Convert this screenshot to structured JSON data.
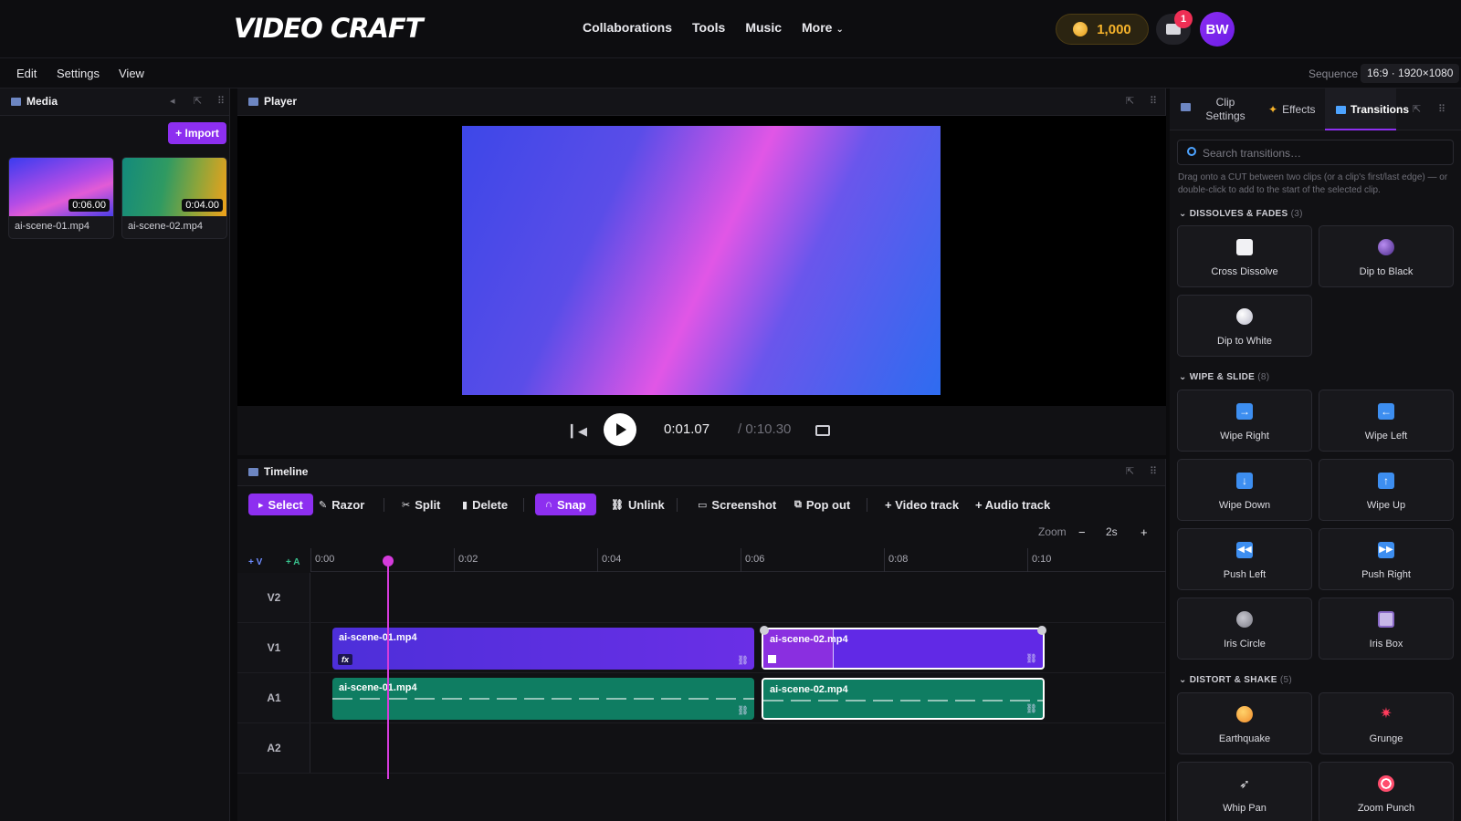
{
  "header": {
    "logo": "VIDEO CRAFT",
    "nav": [
      "Collaborations",
      "Tools",
      "Music",
      "More"
    ],
    "coins": "1,000",
    "notifications": "1",
    "avatar": "BW"
  },
  "menubar": {
    "items": [
      "Edit",
      "Settings",
      "View"
    ],
    "sequence_label": "Sequence",
    "sequence_value": "16:9 · 1920×1080"
  },
  "media": {
    "title": "Media",
    "import_label": "+ Import",
    "items": [
      {
        "name": "ai-scene-01.mp4",
        "duration": "0:06.00"
      },
      {
        "name": "ai-scene-02.mp4",
        "duration": "0:04.00"
      }
    ]
  },
  "player": {
    "title": "Player",
    "current_time": "0:01.07",
    "total_time": "/ 0:10.30"
  },
  "timeline": {
    "title": "Timeline",
    "tools": {
      "select": "Select",
      "razor": "Razor",
      "split": "Split",
      "delete": "Delete",
      "snap": "Snap",
      "unlink": "Unlink",
      "screenshot": "Screenshot",
      "popout": "Pop out",
      "video_track": "+ Video track",
      "audio_track": "+ Audio track"
    },
    "zoom_label": "Zoom",
    "zoom_value": "2s",
    "add_video": "+ V",
    "add_audio": "+ A",
    "ruler": [
      "0:00",
      "0:02",
      "0:04",
      "0:06",
      "0:08",
      "0:10"
    ],
    "tracks": [
      "V2",
      "V1",
      "A1",
      "A2"
    ],
    "clips": {
      "v1_a": "ai-scene-01.mp4",
      "v1_b": "ai-scene-02.mp4",
      "a1_a": "ai-scene-01.mp4",
      "a1_b": "ai-scene-02.mp4"
    }
  },
  "right_panel": {
    "tabs": [
      "Clip Settings",
      "Effects",
      "Transitions"
    ],
    "active_tab": "Transitions",
    "search_placeholder": "Search transitions…",
    "hint": "Drag onto a CUT between two clips (or a clip's first/last edge) — or double-click to add to the start of the selected clip.",
    "sections": [
      {
        "title": "DISSOLVES & FADES",
        "count": "(3)",
        "items": [
          "Cross Dissolve",
          "Dip to Black",
          "Dip to White"
        ]
      },
      {
        "title": "WIPE & SLIDE",
        "count": "(8)",
        "items": [
          "Wipe Right",
          "Wipe Left",
          "Wipe Down",
          "Wipe Up",
          "Push Left",
          "Push Right",
          "Iris Circle",
          "Iris Box"
        ]
      },
      {
        "title": "DISTORT & SHAKE",
        "count": "(5)",
        "items": [
          "Earthquake",
          "Grunge",
          "Whip Pan",
          "Zoom Punch"
        ]
      }
    ]
  },
  "colors": {
    "accent": "#8d2ff0",
    "playhead": "#d53bdc",
    "video_clip": "#5b2ee6",
    "audio_clip": "#0f7d62",
    "coin": "#f6b32b"
  }
}
